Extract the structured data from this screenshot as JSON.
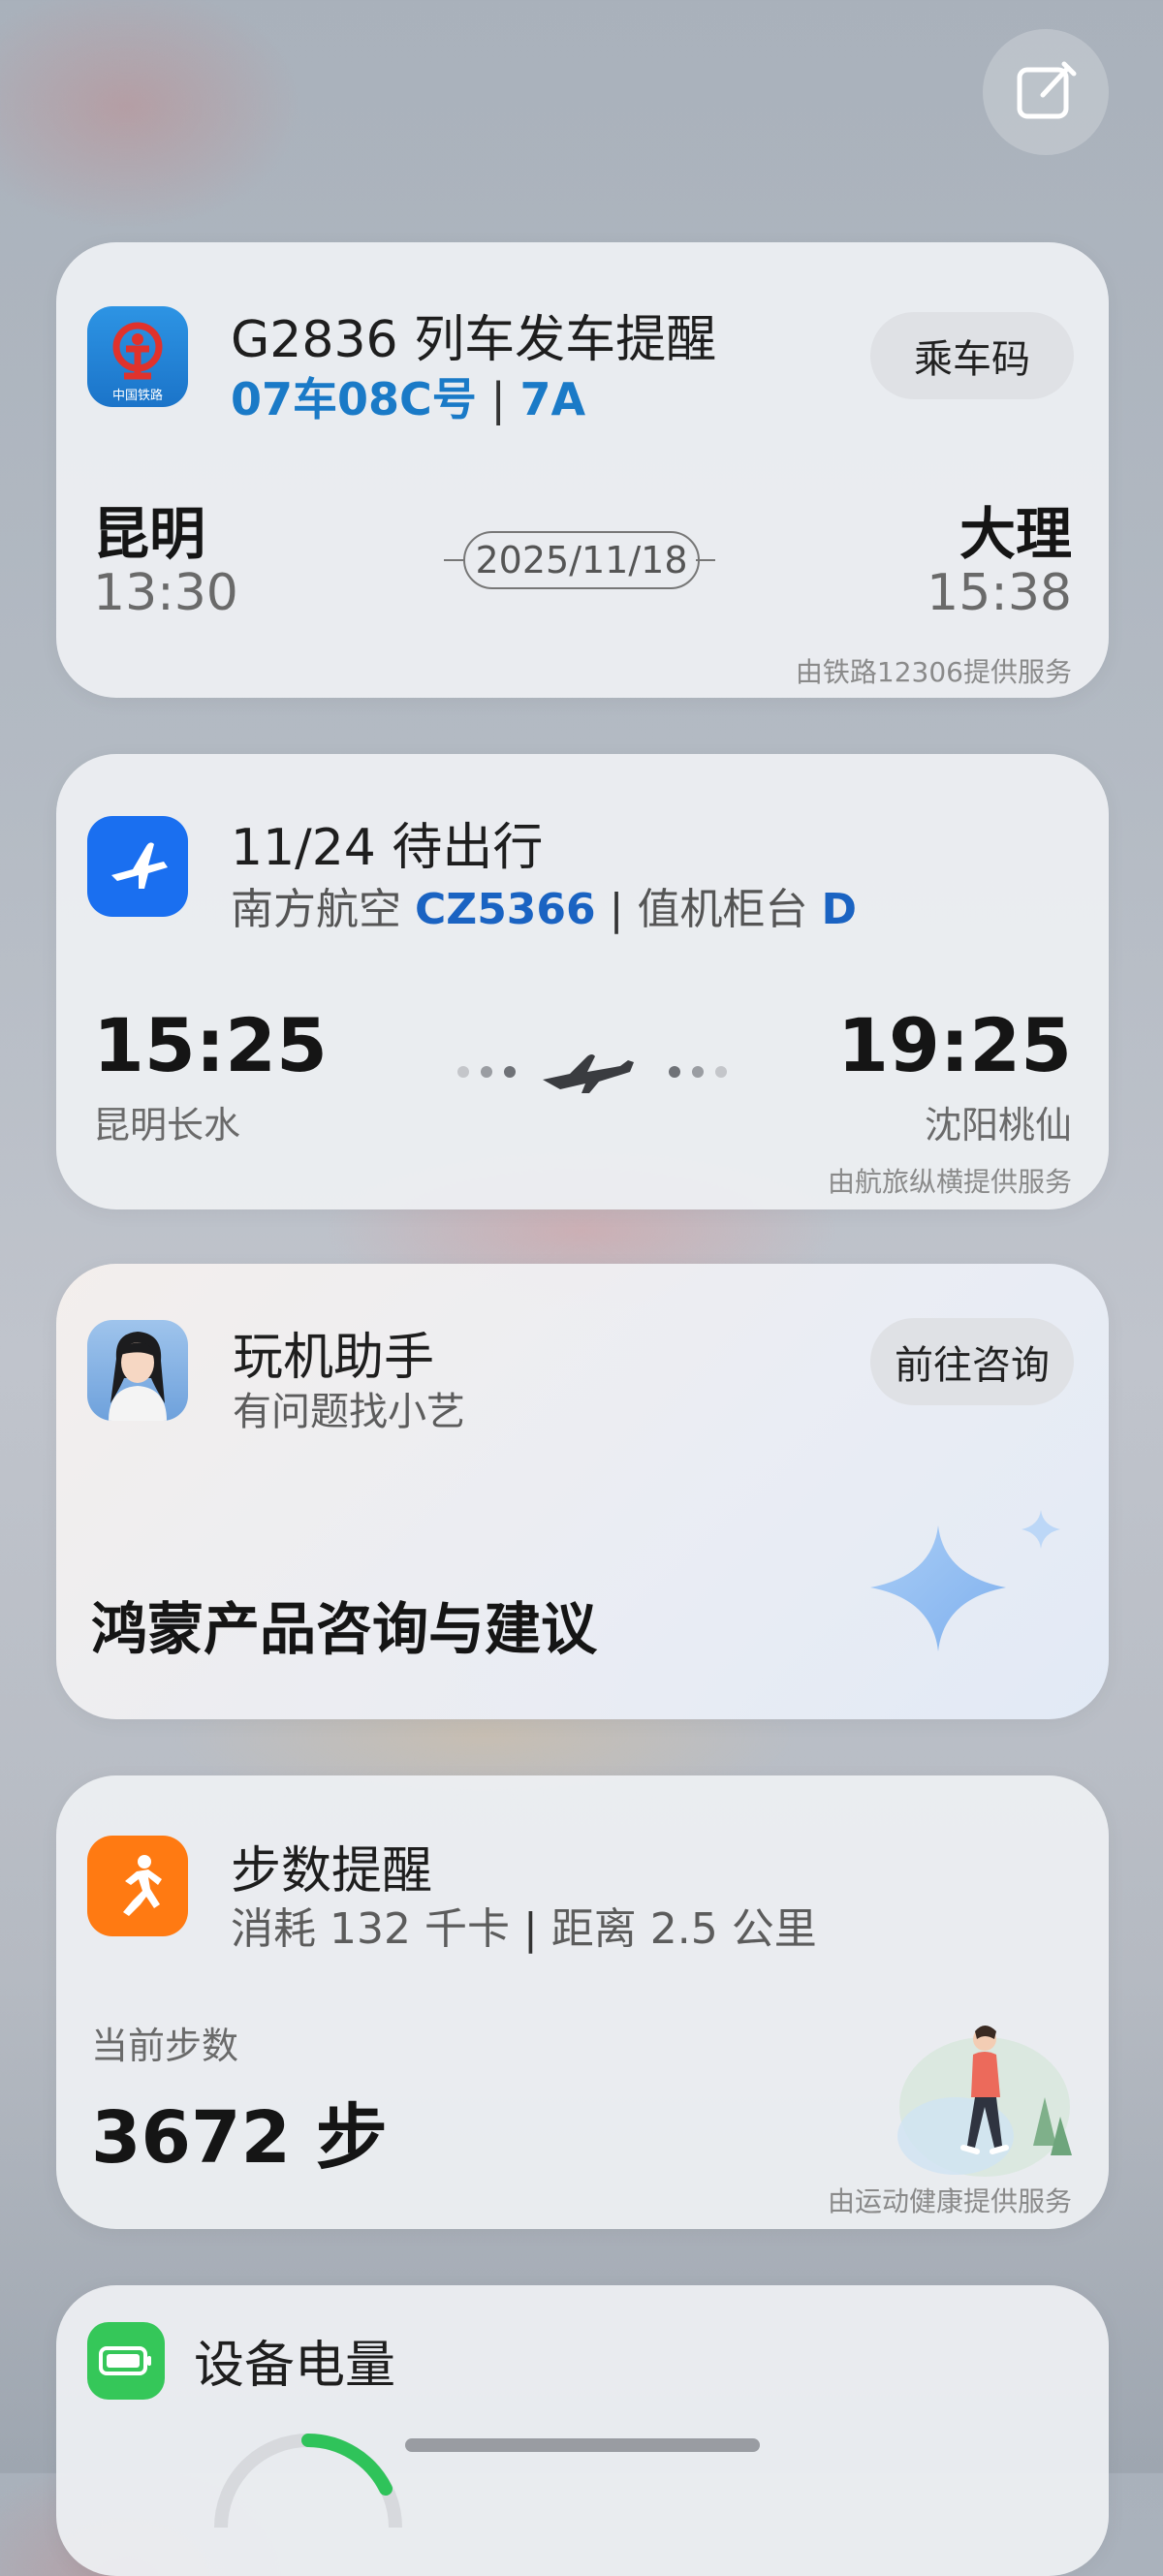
{
  "train": {
    "title": "G2836 列车发车提醒",
    "seat_car": "07车08C号",
    "seat_sep": "|",
    "seat_no": "7A",
    "button": "乘车码",
    "from_city": "昆明",
    "from_time": "13:30",
    "date": "2025/11/18",
    "to_city": "大理",
    "to_time": "15:38",
    "icon_caption": "中国铁路",
    "provider": "由铁路12306提供服务"
  },
  "flight": {
    "title": "11/24 待出行",
    "airline": "南方航空",
    "flight_no": "CZ5366",
    "sep": "|",
    "counter_label": "值机柜台",
    "counter": "D",
    "dep_time": "15:25",
    "dep_airport": "昆明长水",
    "arr_time": "19:25",
    "arr_airport": "沈阳桃仙",
    "provider": "由航旅纵横提供服务"
  },
  "assistant": {
    "title": "玩机助手",
    "subtitle": "有问题找小艺",
    "button": "前往咨询",
    "headline": "鸿蒙产品咨询与建议"
  },
  "steps": {
    "title": "步数提醒",
    "calories": "消耗 132 千卡",
    "sep": "|",
    "distance": "距离 2.5 公里",
    "current_label": "当前步数",
    "count": "3672 步",
    "provider": "由运动健康提供服务"
  },
  "battery": {
    "title": "设备电量"
  },
  "colors": {
    "train_icon_bg": "#1f7fd1",
    "train_logo": "#e0322c",
    "flight_icon_bg": "#1a6ff0",
    "steps_icon_bg": "#ff7a12",
    "battery_icon_bg": "#35c759",
    "battery_ring": "#2fc35a"
  }
}
